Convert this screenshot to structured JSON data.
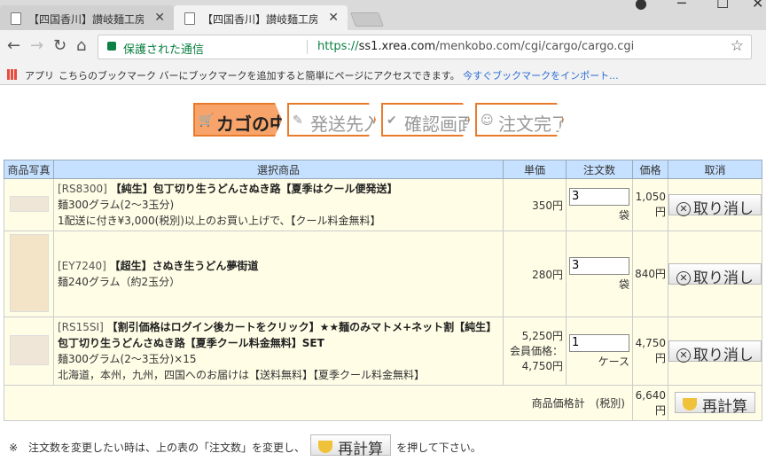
{
  "browser": {
    "tabs": [
      {
        "title": "【四国香川】讃岐麺工房N",
        "active": false
      },
      {
        "title": "【四国香川】讃岐麺工房N",
        "active": true
      }
    ],
    "secure_label": "保護された通信",
    "url_scheme": "https://",
    "url_host": "ss1.xrea.com",
    "url_path": "/menkobo.com/cgi/cargo/cargo.cgi",
    "bookmarks": {
      "apps_label": "アプリ",
      "message": "こちらのブックマーク バーにブックマークを追加すると簡単にページにアクセスできます。",
      "import_link": "今すぐブックマークをインポート..."
    }
  },
  "steps": [
    {
      "label": "カゴの中",
      "active": true
    },
    {
      "label": "発送先入力",
      "active": false
    },
    {
      "label": "確認画面",
      "active": false
    },
    {
      "label": "注文完了",
      "active": false
    }
  ],
  "table": {
    "headers": [
      "商品写真",
      "選択商品",
      "単価",
      "注文数",
      "価格",
      "取消"
    ],
    "rows": [
      {
        "code": "[RS8300]",
        "title": "【純生】包丁切り生うどんさぬき路【夏季はクール便発送】",
        "line2": "麺300グラム(2〜3玉分)",
        "line3": "1配送に付き¥3,000(税別)以上のお買い上げで、【クール料金無料】",
        "unit_price": "350円",
        "qty": "3",
        "unit": "袋",
        "price_top": "1,050",
        "price_bottom": "円",
        "cancel_label": "取り消し"
      },
      {
        "code": "[EY7240]",
        "title": "【超生】さぬき生うどん夢街道",
        "line2": "麺240グラム（約2玉分）",
        "unit_price": "280円",
        "qty": "3",
        "unit": "袋",
        "price_top": "840円",
        "cancel_label": "取り消し"
      },
      {
        "code": "[RS15SI]",
        "title": "【割引価格はログイン後カートをクリック】★★麺のみマトメ+ネット割【純生】包丁切り生うどんさぬき路【夏季クール料金無料】SET",
        "line2": "麺300グラム(2〜3玉分)×15",
        "line3": "北海道，本州，九州，四国へのお届けは【送料無料】【夏季クール料金無料】",
        "unit_price_1": "5,250円",
        "unit_price_2": "会員価格：",
        "unit_price_3": "4,750円",
        "qty": "1",
        "unit": "ケース",
        "price_top": "4,750",
        "price_bottom": "円",
        "cancel_label": "取り消し"
      }
    ],
    "total_label": "商品価格計　(税別)",
    "total_top": "6,640",
    "total_bottom": "円",
    "recalc_label": "再計算"
  },
  "note": {
    "prefix": "※　注文数を変更したい時は、上の表の「注文数」を変更し、",
    "button": "再計算",
    "suffix": "を押して下さい。"
  },
  "colors": {
    "accent": "#e87a2c",
    "header": "#c6e0ff",
    "row": "#fffde6"
  }
}
